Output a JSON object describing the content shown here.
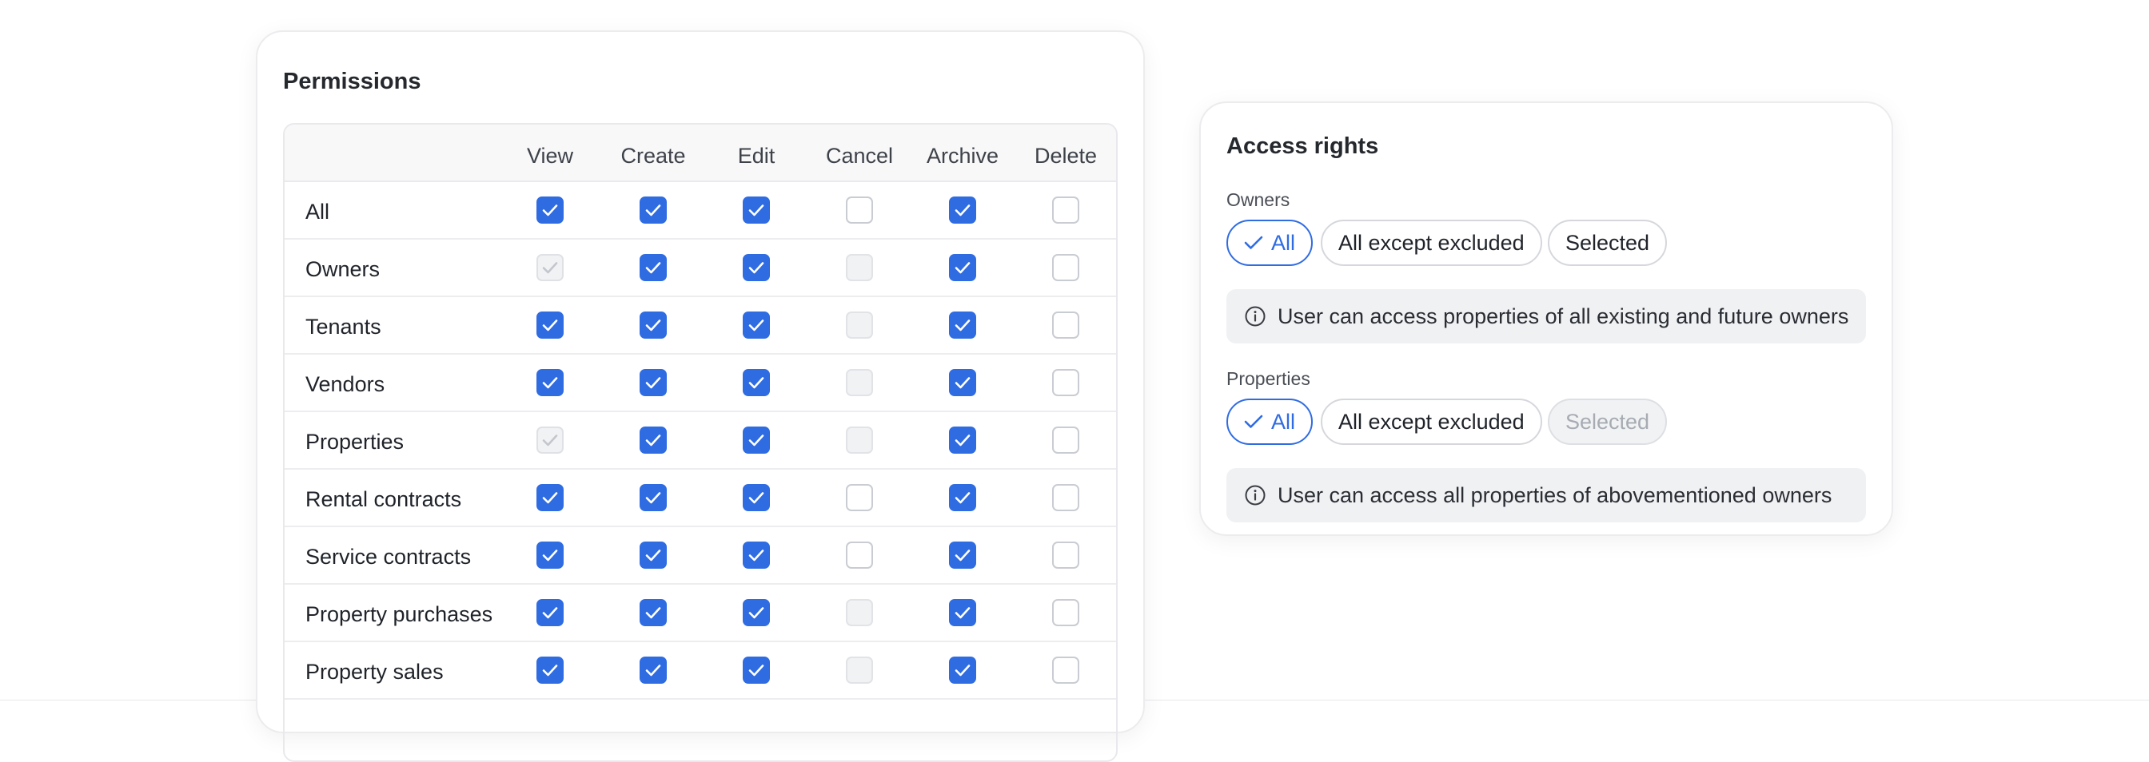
{
  "permissions": {
    "title": "Permissions",
    "columns": [
      "View",
      "Create",
      "Edit",
      "Cancel",
      "Archive",
      "Delete"
    ],
    "rows": [
      {
        "label": "All",
        "states": [
          "checked",
          "checked",
          "checked",
          "unchecked",
          "checked",
          "unchecked"
        ]
      },
      {
        "label": "Owners",
        "states": [
          "disabled-checked",
          "checked",
          "checked",
          "disabled",
          "checked",
          "unchecked"
        ]
      },
      {
        "label": "Tenants",
        "states": [
          "checked",
          "checked",
          "checked",
          "disabled",
          "checked",
          "unchecked"
        ]
      },
      {
        "label": "Vendors",
        "states": [
          "checked",
          "checked",
          "checked",
          "disabled",
          "checked",
          "unchecked"
        ]
      },
      {
        "label": "Properties",
        "states": [
          "disabled-checked",
          "checked",
          "checked",
          "disabled",
          "checked",
          "unchecked"
        ]
      },
      {
        "label": "Rental contracts",
        "states": [
          "checked",
          "checked",
          "checked",
          "unchecked",
          "checked",
          "unchecked"
        ]
      },
      {
        "label": "Service contracts",
        "states": [
          "checked",
          "checked",
          "checked",
          "unchecked",
          "checked",
          "unchecked"
        ]
      },
      {
        "label": "Property purchases",
        "states": [
          "checked",
          "checked",
          "checked",
          "disabled",
          "checked",
          "unchecked"
        ]
      },
      {
        "label": "Property sales",
        "states": [
          "checked",
          "checked",
          "checked",
          "disabled",
          "checked",
          "unchecked"
        ]
      }
    ]
  },
  "access": {
    "title": "Access rights",
    "owners": {
      "label": "Owners",
      "options": [
        {
          "label": "All",
          "state": "selected"
        },
        {
          "label": "All except excluded",
          "state": "default"
        },
        {
          "label": "Selected",
          "state": "default"
        }
      ],
      "info": "User can access properties of all existing and future owners"
    },
    "properties": {
      "label": "Properties",
      "options": [
        {
          "label": "All",
          "state": "selected"
        },
        {
          "label": "All except excluded",
          "state": "default"
        },
        {
          "label": "Selected",
          "state": "disabled"
        }
      ],
      "info": "User can access all properties of abovementioned owners"
    }
  },
  "colors": {
    "accent": "#2f6ce2",
    "checkbox_border": "#c9ccd2",
    "disabled_fill": "#f1f2f4",
    "info_bg": "#f0f1f3"
  },
  "icons": {
    "checkmark": "check-icon",
    "info": "info-icon"
  }
}
